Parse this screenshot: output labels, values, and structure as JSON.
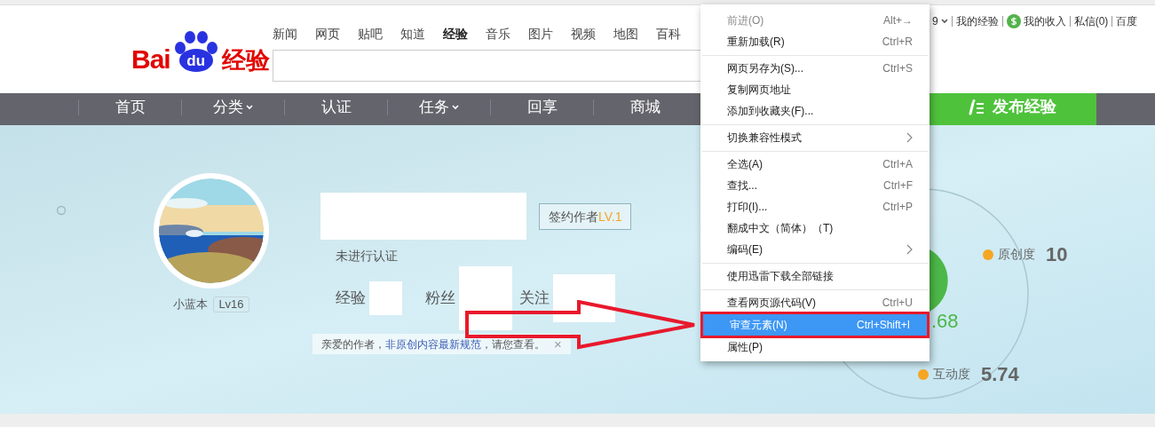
{
  "top_links": [
    {
      "label": "9",
      "kind": "dropdown"
    },
    {
      "label": "我的经验",
      "kind": "link"
    },
    {
      "label": "我的收入",
      "kind": "coin"
    },
    {
      "label": "私信(0)",
      "kind": "link"
    },
    {
      "label": "百度",
      "kind": "link"
    }
  ],
  "logo": {
    "latin": "Bai",
    "badge": "du",
    "cn": "经验"
  },
  "search_tabs": [
    {
      "label": "新闻",
      "selected": false
    },
    {
      "label": "网页",
      "selected": false
    },
    {
      "label": "贴吧",
      "selected": false
    },
    {
      "label": "知道",
      "selected": false
    },
    {
      "label": "经验",
      "selected": true
    },
    {
      "label": "音乐",
      "selected": false
    },
    {
      "label": "图片",
      "selected": false
    },
    {
      "label": "视频",
      "selected": false
    },
    {
      "label": "地图",
      "selected": false
    },
    {
      "label": "百科",
      "selected": false
    }
  ],
  "main_nav": [
    {
      "label": "首页",
      "dropdown": false
    },
    {
      "label": "分类",
      "dropdown": true
    },
    {
      "label": "认证",
      "dropdown": false
    },
    {
      "label": "任务",
      "dropdown": true
    },
    {
      "label": "回享",
      "dropdown": false
    },
    {
      "label": "商城",
      "dropdown": false
    }
  ],
  "publish_button": "发布经验",
  "profile": {
    "nickname": "小蓝本",
    "level": "Lv16",
    "author_badge": "签约作者",
    "author_level": "LV.1",
    "verification": "未进行认证",
    "counts": [
      {
        "label": "经验"
      },
      {
        "label": "粉丝"
      },
      {
        "label": "关注"
      }
    ],
    "notice": "亲爱的作者，",
    "notice_link": "非原创内容最新规范",
    "notice_end": "，请您查看。",
    "notice_close": "×"
  },
  "stats": [
    {
      "kind": "partial",
      "value": ".68"
    },
    {
      "kind": "metric",
      "label": "原创度",
      "value": "10"
    },
    {
      "kind": "metric",
      "label": "互动度",
      "value": "5.74"
    }
  ],
  "context_menu": [
    {
      "kind": "item",
      "label": "前进(O)",
      "shortcut": "Alt+→",
      "disabled": true,
      "selected": false
    },
    {
      "kind": "item",
      "label": "重新加载(R)",
      "shortcut": "Ctrl+R",
      "disabled": false,
      "selected": false
    },
    {
      "kind": "separator"
    },
    {
      "kind": "item",
      "label": "网页另存为(S)...",
      "shortcut": "Ctrl+S",
      "disabled": false,
      "selected": false
    },
    {
      "kind": "item",
      "label": "复制网页地址",
      "disabled": false,
      "selected": false
    },
    {
      "kind": "item",
      "label": "添加到收藏夹(F)...",
      "disabled": false,
      "selected": false
    },
    {
      "kind": "separator"
    },
    {
      "kind": "submenu",
      "label": "切换兼容性模式",
      "disabled": false,
      "selected": false
    },
    {
      "kind": "separator"
    },
    {
      "kind": "item",
      "label": "全选(A)",
      "shortcut": "Ctrl+A",
      "disabled": false,
      "selected": false
    },
    {
      "kind": "item",
      "label": "查找...",
      "shortcut": "Ctrl+F",
      "disabled": false,
      "selected": false
    },
    {
      "kind": "item",
      "label": "打印(I)...",
      "shortcut": "Ctrl+P",
      "disabled": false,
      "selected": false
    },
    {
      "kind": "item",
      "label": "翻成中文（简体）（T)",
      "disabled": false,
      "selected": false
    },
    {
      "kind": "submenu",
      "label": "编码(E)",
      "disabled": false,
      "selected": false
    },
    {
      "kind": "separator"
    },
    {
      "kind": "item",
      "label": "使用迅雷下载全部链接",
      "disabled": false,
      "selected": false
    },
    {
      "kind": "separator"
    },
    {
      "kind": "item",
      "label": "查看网页源代码(V)",
      "shortcut": "Ctrl+U",
      "disabled": false,
      "selected": false
    },
    {
      "kind": "item",
      "label": "审查元素(N)",
      "shortcut": "Ctrl+Shift+I",
      "disabled": false,
      "selected": true
    },
    {
      "kind": "item",
      "label": "属性(P)",
      "disabled": false,
      "selected": false
    }
  ]
}
